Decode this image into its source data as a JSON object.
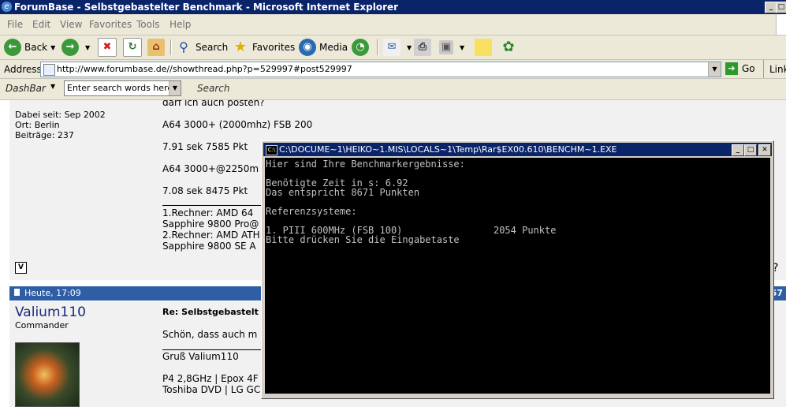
{
  "window": {
    "title": "ForumBase - Selbstgebastelter Benchmark - Microsoft Internet Explorer"
  },
  "menu": [
    "File",
    "Edit",
    "View",
    "Favorites",
    "Tools",
    "Help"
  ],
  "toolbar": {
    "back": "Back",
    "search": "Search",
    "favorites": "Favorites",
    "media": "Media"
  },
  "address": {
    "label": "Address",
    "url": "http://www.forumbase.de//showthread.php?p=529997#post529997",
    "go": "Go",
    "links": "Link"
  },
  "dashbar": {
    "label": "DashBar",
    "placeholder": "Enter search words here",
    "search": "Search"
  },
  "post1": {
    "top_text": "darf ich auch posten?",
    "dabei": "Dabei seit: Sep 2002",
    "ort": "Ort: Berlin",
    "beitraege": "Beiträge: 237",
    "line1": "A64 3000+ (2000mhz) FSB 200",
    "line2": "7.91 sek 7585 Pkt",
    "line3": "A64 3000+@2250m",
    "line4": "7.08 sek 8475 Pkt",
    "sig1": "1.Rechner: AMD 64",
    "sig2": "Sapphire 9800 Pro@",
    "sig3": "2.Rechner: AMD ATH",
    "sig4": "Sapphire 9800 SE A"
  },
  "post2": {
    "date": "Heute, 17:09",
    "postnum_partial": "57",
    "user": "Valium110",
    "rank": "Commander",
    "title": "Re: Selbstgebastelt",
    "body": "Schön, dass auch m",
    "sig1": "Gruß Valium110",
    "sig2": "P4 2,8GHz | Epox 4F",
    "sig3": "Toshiba DVD | LG GC"
  },
  "console": {
    "title": "C:\\DOCUME~1\\HEIKO~1.MIS\\LOCALS~1\\Temp\\Rar$EX00.610\\BENCHM~1.EXE",
    "icon_text": "C:\\",
    "lines": [
      "Hier sind Ihre Benchmarkergebnisse:",
      "",
      "Benötigte Zeit in s: 6.92",
      "Das entspricht 8671 Punkten",
      "",
      "Referenzsysteme:",
      "",
      "1. PIII 600MHz (FSB 100)                2054 Punkte",
      "Bitte drücken Sie die Eingabetaste"
    ]
  }
}
